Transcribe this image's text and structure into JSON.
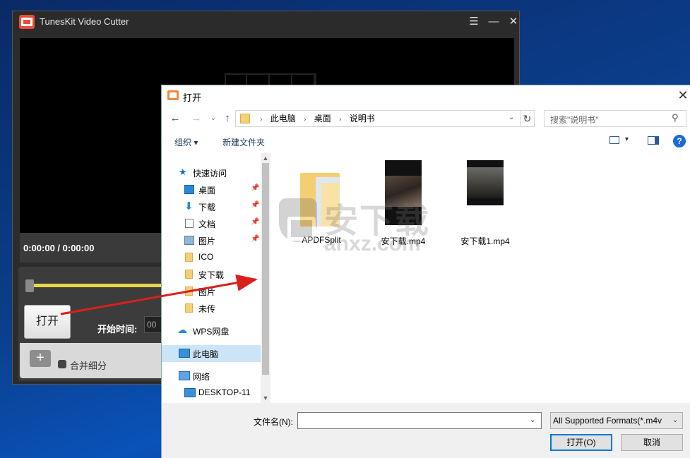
{
  "app": {
    "title": "TunesKit Video Cutter",
    "time_display": "0:00:00 / 0:00:00",
    "open_button": "打开",
    "start_time_label": "开始时间:",
    "start_time_value": "00",
    "merge_label": "合并细分",
    "add_segment": "+",
    "timeline_accent": "#e7d64a"
  },
  "dialog": {
    "title": "打开",
    "close_glyph": "✕",
    "breadcrumbs": [
      "此电脑",
      "桌面",
      "说明书"
    ],
    "search_placeholder": "搜索\"说明书\"",
    "toolbar": {
      "organize": "组织 ▾",
      "new_folder": "新建文件夹",
      "help": "?"
    },
    "nav": {
      "quick_access": "快速访问",
      "items": [
        {
          "label": "桌面",
          "icon": "desktop-icon",
          "pinned": true
        },
        {
          "label": "下载",
          "icon": "download-icon",
          "pinned": true
        },
        {
          "label": "文档",
          "icon": "document-icon",
          "pinned": true
        },
        {
          "label": "图片",
          "icon": "picture-icon",
          "pinned": true
        },
        {
          "label": "ICO",
          "icon": "folder-icon",
          "pinned": false
        },
        {
          "label": "安下载",
          "icon": "folder-icon",
          "pinned": false
        },
        {
          "label": "图片",
          "icon": "folder-icon",
          "pinned": false
        },
        {
          "label": "未传",
          "icon": "folder-icon",
          "pinned": false
        }
      ],
      "wps": "WPS网盘",
      "this_pc": "此电脑",
      "network": "网络",
      "desktop_pc": "DESKTOP-11"
    },
    "files": [
      {
        "name": "APDFSplit",
        "type": "folder"
      },
      {
        "name": "安下载.mp4",
        "type": "video"
      },
      {
        "name": "安下载1.mp4",
        "type": "video"
      }
    ],
    "filename_label": "文件名(N):",
    "filename_value": "",
    "filetype_value": "All Supported Formats(*.m4v",
    "open_button": "打开(O)",
    "cancel_button": "取消",
    "accent_color": "#0078d7"
  },
  "watermark": {
    "text": "安下载",
    "domain": "anxz.com"
  },
  "annotation": {
    "arrow_color": "#d9201c"
  }
}
